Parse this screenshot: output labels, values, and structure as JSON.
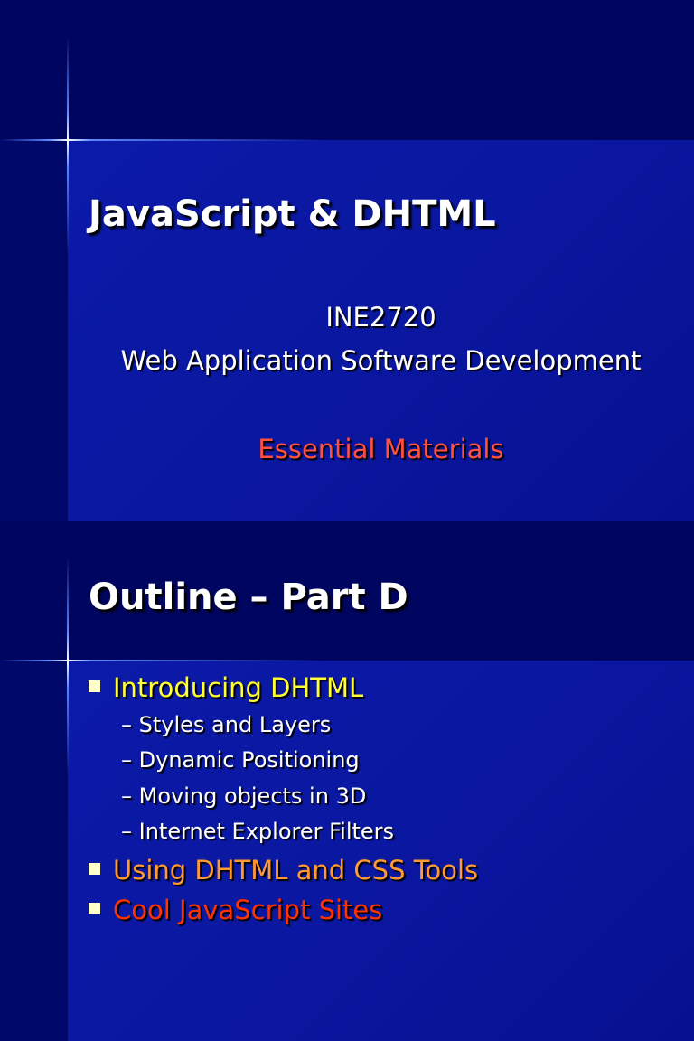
{
  "slide1": {
    "title": "JavaScript & DHTML",
    "course_code": "INE2720",
    "course_name": "Web Application Software Development",
    "subtitle": "Essential Materials"
  },
  "slide2": {
    "title": "Outline – Part D",
    "bullets": [
      {
        "label": "Introducing DHTML",
        "color": "#ffff33",
        "sub": [
          "– Styles and Layers",
          "– Dynamic Positioning",
          "– Moving objects in 3D",
          "– Internet Explorer Filters"
        ]
      },
      {
        "label": "Using DHTML and CSS Tools",
        "color": "#ff9933"
      },
      {
        "label": "Cool JavaScript Sites",
        "color": "#ff3300"
      }
    ]
  }
}
